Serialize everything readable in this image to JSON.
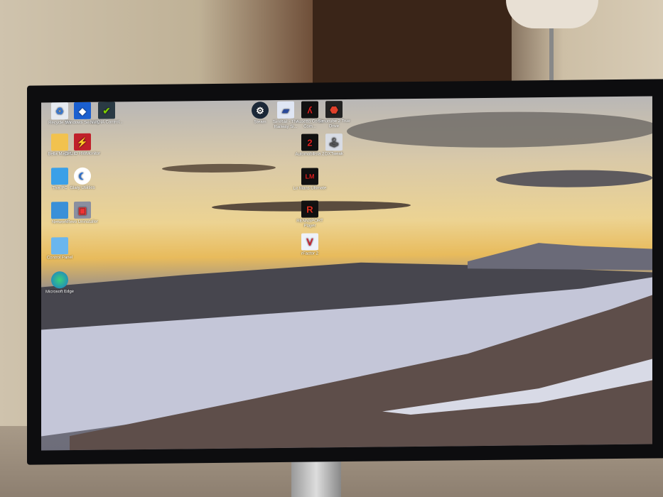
{
  "desktop": {
    "left_icons": [
      {
        "label": "Recycle Bin",
        "icon": "recycle-bin-icon"
      },
      {
        "label": "Windows Security",
        "icon": "shield-icon"
      },
      {
        "label": "NVIDIA Control...",
        "icon": "nvidia-icon"
      },
      {
        "label": "Bella Mayed",
        "icon": "folder-icon"
      },
      {
        "label": "CPUID HWMonitor",
        "icon": "hwmonitor-icon"
      },
      {
        "label": "This PC",
        "icon": "computer-icon"
      },
      {
        "label": "Glary Utilities",
        "icon": "glary-icon"
      },
      {
        "label": "Network",
        "icon": "network-icon"
      },
      {
        "label": "Revo Uninstaller",
        "icon": "revo-icon"
      },
      {
        "label": "Control Panel",
        "icon": "control-panel-icon"
      },
      {
        "label": "Microsoft Edge",
        "icon": "edge-icon"
      }
    ],
    "game_icons": [
      {
        "label": "Steam",
        "icon": "steam-icon"
      },
      {
        "label": "SimRail - The Railway Si...",
        "icon": "simrail-icon"
      },
      {
        "label": "Assetto Corsa Com...",
        "icon": "assetto-corsa-icon"
      },
      {
        "label": "Simucube 2 True Drive",
        "icon": "simucube-icon"
      },
      {
        "label": "Automobilista 2",
        "icon": "automobilista-icon"
      },
      {
        "label": "DXTweak",
        "icon": "joystick-icon"
      },
      {
        "label": "Le Mans Ultimate",
        "icon": "lmu-icon"
      },
      {
        "label": "RENNSPORT Player",
        "icon": "rennsport-icon"
      },
      {
        "label": "rFactor 2",
        "icon": "rfactor-icon"
      }
    ]
  }
}
